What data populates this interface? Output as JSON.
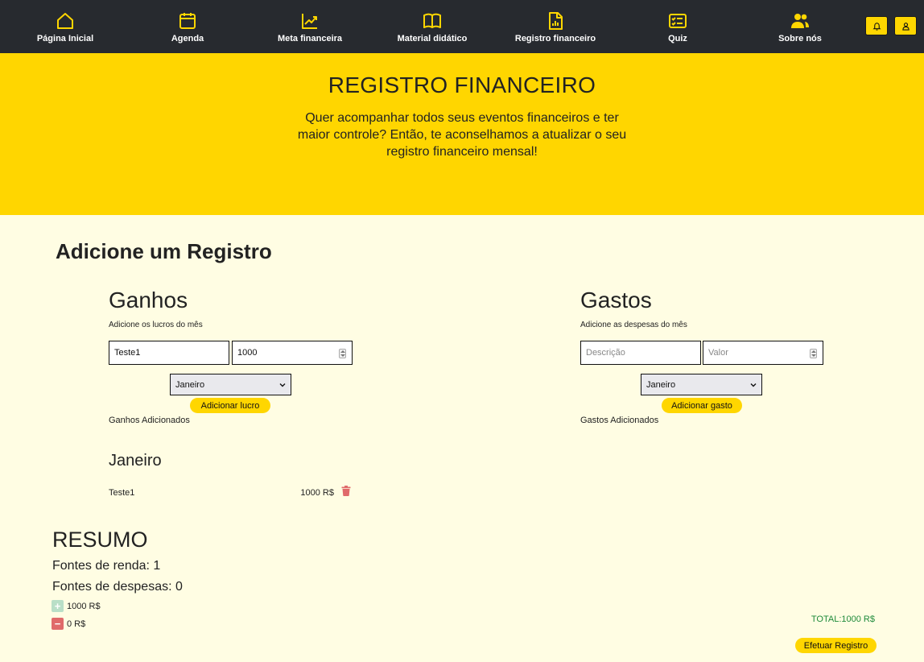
{
  "nav": {
    "items": [
      {
        "label": "Página Inicial",
        "icon": "home-icon"
      },
      {
        "label": "Agenda",
        "icon": "calendar-icon"
      },
      {
        "label": "Meta financeira",
        "icon": "trend-chart-icon"
      },
      {
        "label": "Material didático",
        "icon": "book-icon"
      },
      {
        "label": "Registro financeiro",
        "icon": "report-file-icon"
      },
      {
        "label": "Quiz",
        "icon": "checklist-icon"
      },
      {
        "label": "Sobre nós",
        "icon": "users-icon"
      }
    ],
    "notification_icon": "bell-icon",
    "profile_icon": "user-icon"
  },
  "hero": {
    "title": "REGISTRO FINANCEIRO",
    "description": "Quer acompanhar todos seus eventos financeiros e ter maior controle? Então, te aconselhamos a atualizar o seu registro financeiro mensal!"
  },
  "main": {
    "title": "Adicione um Registro",
    "gains": {
      "title": "Ganhos",
      "subtitle": "Adicione os lucros do mês",
      "description_value": "Teste1",
      "value_value": "1000",
      "month": "Janeiro",
      "button": "Adicionar lucro",
      "added_label": "Ganhos Adicionados",
      "groups": [
        {
          "month": "Janeiro",
          "entries": [
            {
              "name": "Teste1",
              "amount": "1000 R$"
            }
          ]
        }
      ]
    },
    "expenses": {
      "title": "Gastos",
      "subtitle": "Adicione as despesas do mês",
      "description_placeholder": "Descrição",
      "value_placeholder": "Valor",
      "month": "Janeiro",
      "button": "Adicionar gasto",
      "added_label": "Gastos Adicionados"
    }
  },
  "summary": {
    "title": "RESUMO",
    "income_sources": "Fontes de renda: 1",
    "expense_sources": "Fontes de despesas: 0",
    "income_total": "1000 R$",
    "expense_total": "0 R$",
    "total": "TOTAL:1000 R$",
    "submit": "Efetuar Registro"
  },
  "colors": {
    "nav_bg": "#272a2f",
    "accent": "#ffd600",
    "page_bg": "#fffde3",
    "income": "#b9dfc7",
    "expense": "#e06a6a",
    "total": "#1e8a3a"
  }
}
